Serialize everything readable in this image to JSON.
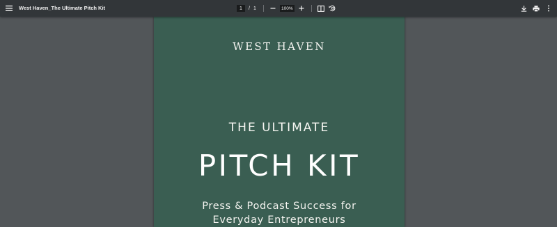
{
  "toolbar": {
    "menu_icon": "hamburger-menu-icon",
    "title": "West Haven_The Ultimate Pitch Kit",
    "page": {
      "current": "1",
      "separator": "/",
      "total": "1"
    },
    "zoom": {
      "value": "100%",
      "zoom_out_icon": "minus-icon",
      "zoom_in_icon": "plus-icon"
    },
    "fit_icon": "fit-to-page-icon",
    "rotate_icon": "rotate-counterclockwise-icon",
    "download_icon": "download-icon",
    "print_icon": "print-icon",
    "more_icon": "more-vertical-icon"
  },
  "document": {
    "brand": "WEST HAVEN",
    "subtitle": "THE ULTIMATE",
    "headline": "PITCH KIT",
    "tagline_line1": "Press & Podcast Success for",
    "tagline_line2": "Everyday Entrepreneurs",
    "background_color": "#3a5e52"
  }
}
